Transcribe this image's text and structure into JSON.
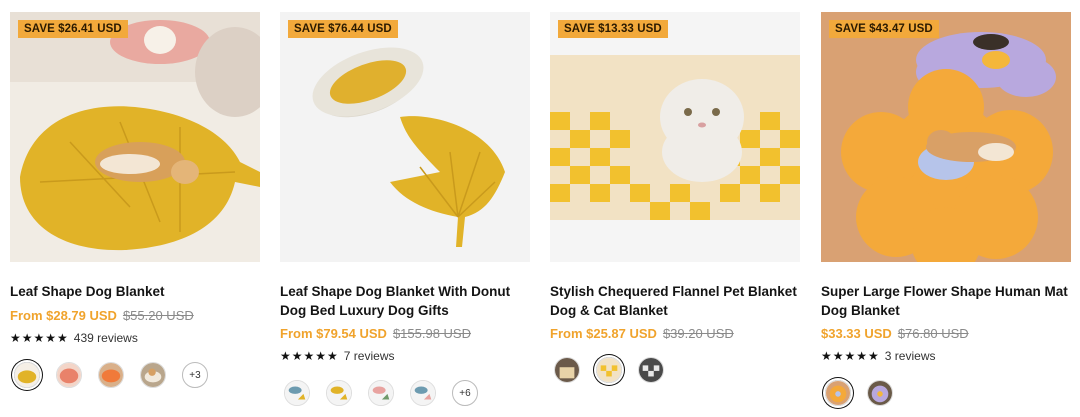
{
  "products": [
    {
      "badge": "SAVE $26.41 USD",
      "title": "Leaf Shape Dog Blanket",
      "sale_price": "From $28.79 USD",
      "compare_price": "$55.20 USD",
      "stars": "★★★★★",
      "reviews": "439 reviews",
      "more_swatches": "+3",
      "image_description": "dog-on-yellow-leaf-blanket"
    },
    {
      "badge": "SAVE $76.44 USD",
      "title": "Leaf Shape Dog Blanket With Donut Dog Bed Luxury Dog Gifts",
      "sale_price": "From $79.54 USD",
      "compare_price": "$155.98 USD",
      "stars": "★★★★★",
      "reviews": "7 reviews",
      "more_swatches": "+6",
      "image_description": "donut-bed-and-leaf-blanket"
    },
    {
      "badge": "SAVE $13.33 USD",
      "title": "Stylish Chequered Flannel Pet Blanket Dog & Cat Blanket",
      "sale_price": "From $25.87 USD",
      "compare_price": "$39.20 USD",
      "image_description": "cat-on-checkered-blanket"
    },
    {
      "badge": "SAVE $43.47 USD",
      "title": "Super Large Flower Shape Human Mat Dog Blanket",
      "sale_price": "$33.33 USD",
      "compare_price": "$76.80 USD",
      "stars": "★★★★★",
      "reviews": "3 reviews",
      "image_description": "dog-on-orange-flower-mat"
    }
  ],
  "colors": {
    "accent": "#f2a93b",
    "sale_price": "#f0a32c",
    "compare_price": "#8a8a8a"
  }
}
